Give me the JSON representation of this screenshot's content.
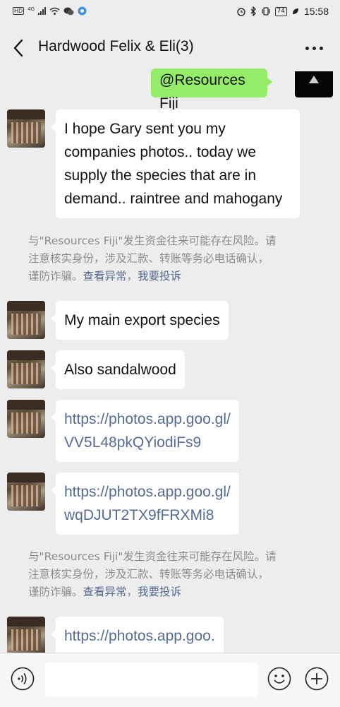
{
  "status_bar": {
    "network": "HD",
    "signal_type": "4G",
    "battery": "74",
    "time": "15:58"
  },
  "header": {
    "title": "Hardwood Felix & Eli(3)"
  },
  "messages": {
    "m0_text": "@Resources Fiji",
    "m1_lines": [
      "I hope Gary sent you my",
      "companies photos.. today we",
      "supply the species that are in",
      "demand.. raintree and mahogany"
    ],
    "m2_text": "My main export species",
    "m3_text": "Also sandalwood",
    "m4_lines": [
      "https://photos.app.goo.gl/",
      "VV5L48pkQYiodiFs9"
    ],
    "m5_lines": [
      "https://photos.app.goo.gl/",
      "wqDJUT2TX9fFRXMi8"
    ],
    "m6_lines": [
      "https://photos.app.goo."
    ]
  },
  "warning": {
    "line1": "与\"Resources Fiji\"发生资金往来可能存在风险。请",
    "line2": "注意核实身份，涉及汇款、转账等务必电话确认，",
    "line3_text": "谨防诈骗。",
    "link_view": "查看异常",
    "sep": "，",
    "link_report": "我要投诉"
  },
  "bottom_bar": {
    "voice_icon": "voice-icon",
    "emoji_icon": "emoji-icon",
    "add_icon": "plus-icon"
  },
  "colors": {
    "background": "#ededed",
    "sent_bubble": "#95ec69",
    "received_bubble": "#ffffff",
    "link": "#566b94",
    "system_text": "#8c8c8c"
  }
}
